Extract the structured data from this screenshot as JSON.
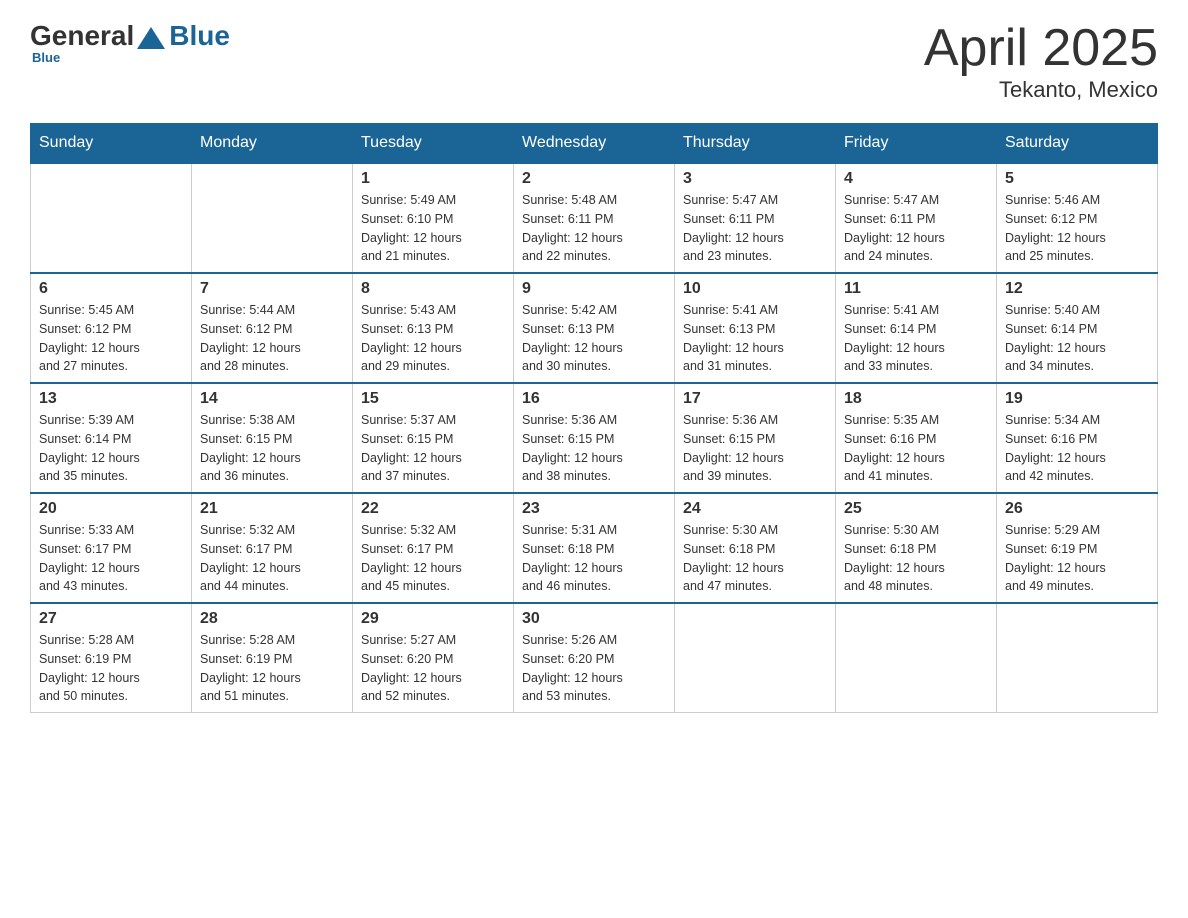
{
  "header": {
    "logo_general": "General",
    "logo_blue": "Blue",
    "title": "April 2025",
    "subtitle": "Tekanto, Mexico"
  },
  "weekdays": [
    "Sunday",
    "Monday",
    "Tuesday",
    "Wednesday",
    "Thursday",
    "Friday",
    "Saturday"
  ],
  "weeks": [
    [
      {
        "day": "",
        "info": ""
      },
      {
        "day": "",
        "info": ""
      },
      {
        "day": "1",
        "info": "Sunrise: 5:49 AM\nSunset: 6:10 PM\nDaylight: 12 hours\nand 21 minutes."
      },
      {
        "day": "2",
        "info": "Sunrise: 5:48 AM\nSunset: 6:11 PM\nDaylight: 12 hours\nand 22 minutes."
      },
      {
        "day": "3",
        "info": "Sunrise: 5:47 AM\nSunset: 6:11 PM\nDaylight: 12 hours\nand 23 minutes."
      },
      {
        "day": "4",
        "info": "Sunrise: 5:47 AM\nSunset: 6:11 PM\nDaylight: 12 hours\nand 24 minutes."
      },
      {
        "day": "5",
        "info": "Sunrise: 5:46 AM\nSunset: 6:12 PM\nDaylight: 12 hours\nand 25 minutes."
      }
    ],
    [
      {
        "day": "6",
        "info": "Sunrise: 5:45 AM\nSunset: 6:12 PM\nDaylight: 12 hours\nand 27 minutes."
      },
      {
        "day": "7",
        "info": "Sunrise: 5:44 AM\nSunset: 6:12 PM\nDaylight: 12 hours\nand 28 minutes."
      },
      {
        "day": "8",
        "info": "Sunrise: 5:43 AM\nSunset: 6:13 PM\nDaylight: 12 hours\nand 29 minutes."
      },
      {
        "day": "9",
        "info": "Sunrise: 5:42 AM\nSunset: 6:13 PM\nDaylight: 12 hours\nand 30 minutes."
      },
      {
        "day": "10",
        "info": "Sunrise: 5:41 AM\nSunset: 6:13 PM\nDaylight: 12 hours\nand 31 minutes."
      },
      {
        "day": "11",
        "info": "Sunrise: 5:41 AM\nSunset: 6:14 PM\nDaylight: 12 hours\nand 33 minutes."
      },
      {
        "day": "12",
        "info": "Sunrise: 5:40 AM\nSunset: 6:14 PM\nDaylight: 12 hours\nand 34 minutes."
      }
    ],
    [
      {
        "day": "13",
        "info": "Sunrise: 5:39 AM\nSunset: 6:14 PM\nDaylight: 12 hours\nand 35 minutes."
      },
      {
        "day": "14",
        "info": "Sunrise: 5:38 AM\nSunset: 6:15 PM\nDaylight: 12 hours\nand 36 minutes."
      },
      {
        "day": "15",
        "info": "Sunrise: 5:37 AM\nSunset: 6:15 PM\nDaylight: 12 hours\nand 37 minutes."
      },
      {
        "day": "16",
        "info": "Sunrise: 5:36 AM\nSunset: 6:15 PM\nDaylight: 12 hours\nand 38 minutes."
      },
      {
        "day": "17",
        "info": "Sunrise: 5:36 AM\nSunset: 6:15 PM\nDaylight: 12 hours\nand 39 minutes."
      },
      {
        "day": "18",
        "info": "Sunrise: 5:35 AM\nSunset: 6:16 PM\nDaylight: 12 hours\nand 41 minutes."
      },
      {
        "day": "19",
        "info": "Sunrise: 5:34 AM\nSunset: 6:16 PM\nDaylight: 12 hours\nand 42 minutes."
      }
    ],
    [
      {
        "day": "20",
        "info": "Sunrise: 5:33 AM\nSunset: 6:17 PM\nDaylight: 12 hours\nand 43 minutes."
      },
      {
        "day": "21",
        "info": "Sunrise: 5:32 AM\nSunset: 6:17 PM\nDaylight: 12 hours\nand 44 minutes."
      },
      {
        "day": "22",
        "info": "Sunrise: 5:32 AM\nSunset: 6:17 PM\nDaylight: 12 hours\nand 45 minutes."
      },
      {
        "day": "23",
        "info": "Sunrise: 5:31 AM\nSunset: 6:18 PM\nDaylight: 12 hours\nand 46 minutes."
      },
      {
        "day": "24",
        "info": "Sunrise: 5:30 AM\nSunset: 6:18 PM\nDaylight: 12 hours\nand 47 minutes."
      },
      {
        "day": "25",
        "info": "Sunrise: 5:30 AM\nSunset: 6:18 PM\nDaylight: 12 hours\nand 48 minutes."
      },
      {
        "day": "26",
        "info": "Sunrise: 5:29 AM\nSunset: 6:19 PM\nDaylight: 12 hours\nand 49 minutes."
      }
    ],
    [
      {
        "day": "27",
        "info": "Sunrise: 5:28 AM\nSunset: 6:19 PM\nDaylight: 12 hours\nand 50 minutes."
      },
      {
        "day": "28",
        "info": "Sunrise: 5:28 AM\nSunset: 6:19 PM\nDaylight: 12 hours\nand 51 minutes."
      },
      {
        "day": "29",
        "info": "Sunrise: 5:27 AM\nSunset: 6:20 PM\nDaylight: 12 hours\nand 52 minutes."
      },
      {
        "day": "30",
        "info": "Sunrise: 5:26 AM\nSunset: 6:20 PM\nDaylight: 12 hours\nand 53 minutes."
      },
      {
        "day": "",
        "info": ""
      },
      {
        "day": "",
        "info": ""
      },
      {
        "day": "",
        "info": ""
      }
    ]
  ]
}
